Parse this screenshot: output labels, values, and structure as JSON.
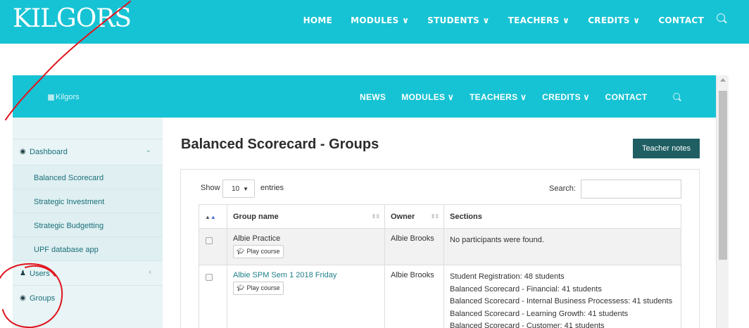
{
  "outer_header": {
    "logo": "KILGORS",
    "nav": [
      "HOME",
      "MODULES ∨",
      "STUDENTS ∨",
      "TEACHERS ∨",
      "CREDITS ∨",
      "CONTACT"
    ]
  },
  "inner_header": {
    "logo_alt": "Kilgors",
    "nav": [
      "NEWS",
      "MODULES ∨",
      "TEACHERS ∨",
      "CREDITS ∨",
      "CONTACT"
    ]
  },
  "sidebar": {
    "dashboard": "Dashboard",
    "sub_items": [
      "Balanced Scorecard",
      "Strategic Investment",
      "Strategic Budgetting",
      "UPF database app"
    ],
    "users": "Users",
    "groups": "Groups"
  },
  "main": {
    "title": "Balanced Scorecard - Groups",
    "teacher_notes": "Teacher notes",
    "show_label": "Show",
    "entries_value": "10",
    "entries_label": "entries",
    "search_label": "Search:"
  },
  "table": {
    "headers": [
      "Group name",
      "Owner",
      "Sections"
    ],
    "play_label": "Play course",
    "rows": [
      {
        "group": "Albie Practice",
        "owner": "Albie Brooks",
        "sections": [
          "No participants were found."
        ]
      },
      {
        "group": "Albie SPM Sem 1 2018 Friday",
        "owner": "Albie Brooks",
        "sections": [
          "Student Registration: 48 students",
          "Balanced Scorecard - Financial: 41 students",
          "Balanced Scorecard - Internal Business Processess: 41 students",
          "Balanced Scorecard - Learning Growth: 41 students",
          "Balanced Scorecard - Customer: 41 students"
        ]
      }
    ]
  },
  "colors": {
    "header_bg": "#16c3d4",
    "sidebar_bg": "#e8f4f6",
    "button_bg": "#1f5f63",
    "annotation": "#e0141e"
  }
}
